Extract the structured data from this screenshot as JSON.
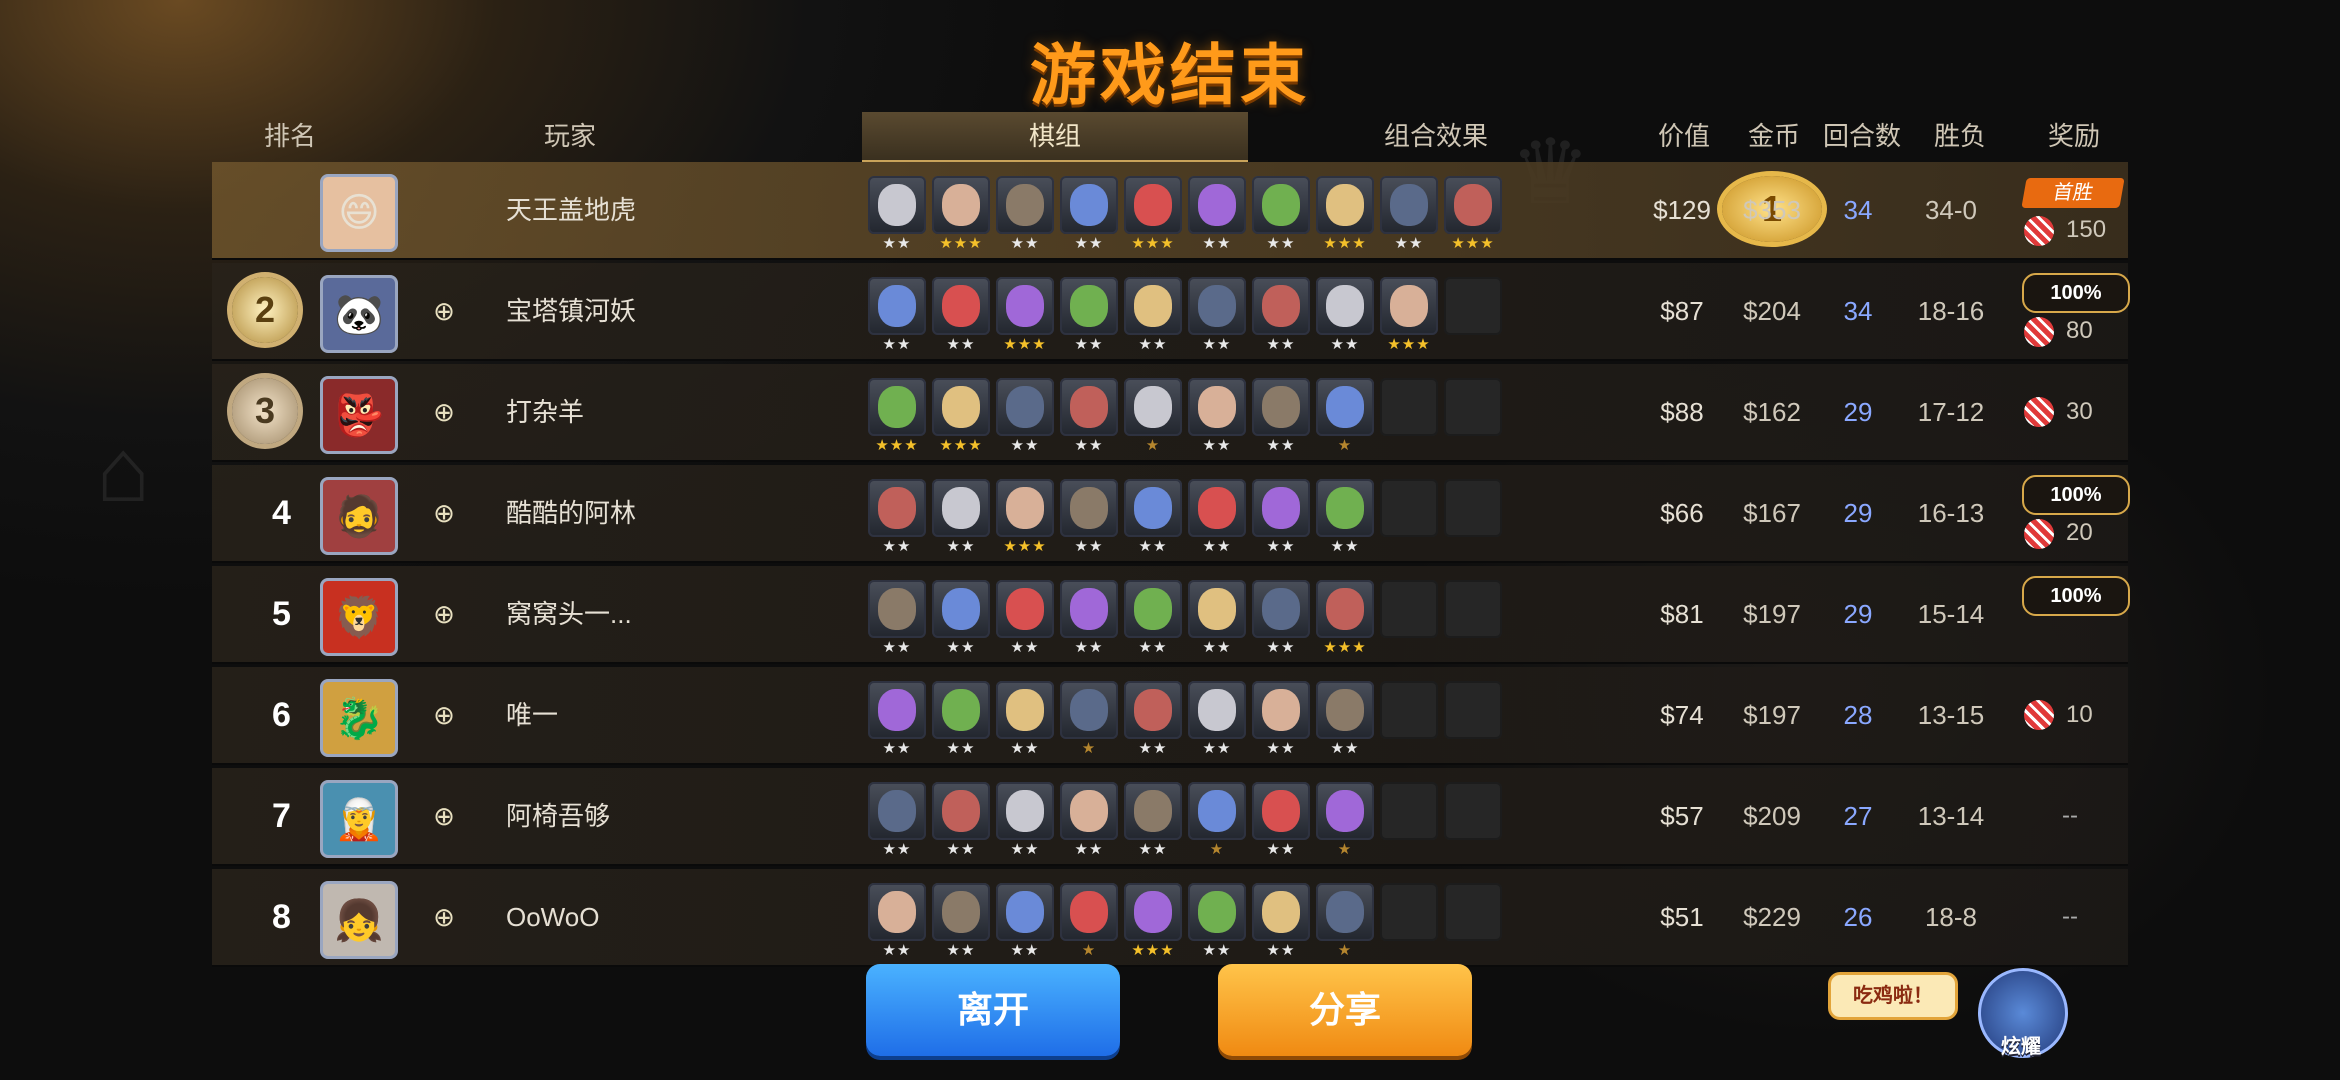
{
  "title": "游戏结束",
  "headers": {
    "rank": "排名",
    "player": "玩家",
    "lineup": "棋组",
    "synergy": "组合效果",
    "value": "价值",
    "gold": "金币",
    "rounds": "回合数",
    "winloss": "胜负",
    "reward": "奖励"
  },
  "rows": [
    {
      "rank": "1",
      "name": "天王盖地虎",
      "value": "$129",
      "gold": "$353",
      "rounds": "34",
      "wl": "34-0",
      "reward_badge": "首胜",
      "reward_count": "150"
    },
    {
      "rank": "2",
      "name": "宝塔镇河妖",
      "value": "$87",
      "gold": "$204",
      "rounds": "34",
      "wl": "18-16",
      "reward_badge": "100%",
      "reward_count": "80"
    },
    {
      "rank": "3",
      "name": "打杂羊",
      "value": "$88",
      "gold": "$162",
      "rounds": "29",
      "wl": "17-12",
      "reward_badge": "",
      "reward_count": "30"
    },
    {
      "rank": "4",
      "name": "酷酷的阿林",
      "value": "$66",
      "gold": "$167",
      "rounds": "29",
      "wl": "16-13",
      "reward_badge": "100%",
      "reward_count": "20"
    },
    {
      "rank": "5",
      "name": "窝窝头一...",
      "value": "$81",
      "gold": "$197",
      "rounds": "29",
      "wl": "15-14",
      "reward_badge": "100%",
      "reward_count": ""
    },
    {
      "rank": "6",
      "name": "唯一",
      "value": "$74",
      "gold": "$197",
      "rounds": "28",
      "wl": "13-15",
      "reward_badge": "",
      "reward_count": "10"
    },
    {
      "rank": "7",
      "name": "阿椅吾够",
      "value": "$57",
      "gold": "$209",
      "rounds": "27",
      "wl": "13-14",
      "reward_badge": "",
      "reward_count": "--"
    },
    {
      "rank": "8",
      "name": "OoWoO",
      "value": "$51",
      "gold": "$229",
      "rounds": "26",
      "wl": "18-8",
      "reward_badge": "",
      "reward_count": "--"
    }
  ],
  "lineups": [
    [
      2,
      3,
      2,
      2,
      3,
      2,
      2,
      3,
      2,
      3
    ],
    [
      2,
      2,
      3,
      2,
      2,
      2,
      2,
      2,
      3,
      0
    ],
    [
      3,
      3,
      2,
      2,
      1,
      2,
      2,
      1,
      0,
      0
    ],
    [
      2,
      2,
      3,
      2,
      2,
      2,
      2,
      2,
      0,
      0
    ],
    [
      2,
      2,
      2,
      2,
      2,
      2,
      2,
      3,
      0,
      0
    ],
    [
      2,
      2,
      2,
      1,
      2,
      2,
      2,
      2,
      0,
      0
    ],
    [
      2,
      2,
      2,
      2,
      2,
      1,
      2,
      1,
      0,
      0
    ],
    [
      2,
      2,
      2,
      1,
      3,
      2,
      2,
      1,
      0,
      0
    ]
  ],
  "buttons": {
    "leave": "离开",
    "share": "分享"
  },
  "bubble": "吃鸡啦！",
  "mascot_label": "炫耀"
}
